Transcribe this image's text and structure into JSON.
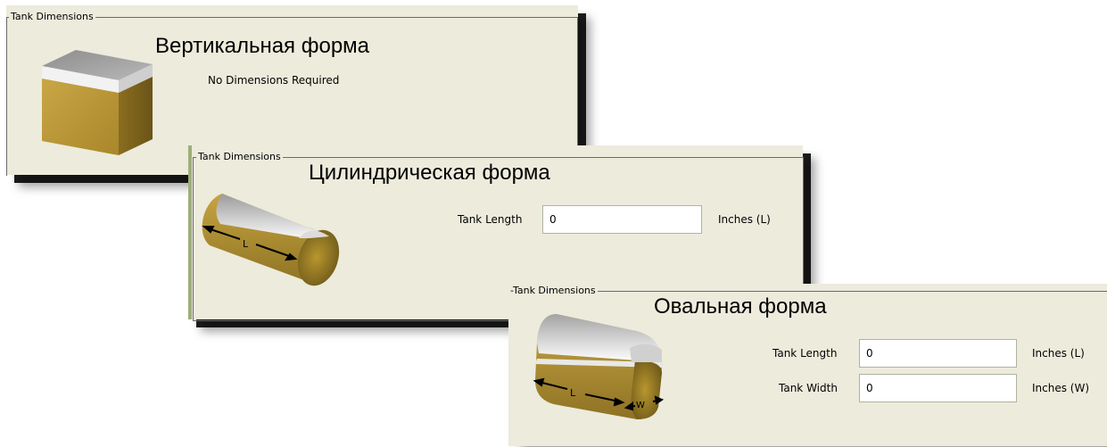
{
  "panels": {
    "vertical": {
      "group_label": "Tank Dimensions",
      "title": "Вертикальная форма",
      "message": "No Dimensions Required"
    },
    "cylindrical": {
      "group_label": "Tank Dimensions",
      "title": "Цилиндрическая форма",
      "length_label": "Tank Length",
      "length_value": "0",
      "length_unit": "Inches (L)",
      "diagram_label_l": "L"
    },
    "oval": {
      "group_label": "-Tank Dimensions",
      "title": "Овальная форма",
      "length_label": "Tank Length",
      "length_value": "0",
      "length_unit": "Inches (L)",
      "width_label": "Tank Width",
      "width_value": "0",
      "width_unit": "Inches (W)",
      "diagram_label_l": "L",
      "diagram_label_w": "W"
    }
  },
  "colors": {
    "panel_bg": "#ecebdc",
    "tank_gold": "#b8962e",
    "tank_silver": "#d9d9d9",
    "field_border": "#aeb59e",
    "accent_left_bar": "#9fae79"
  },
  "icons": [
    "vertical-tank-icon",
    "cylindrical-tank-icon",
    "oval-tank-icon",
    "dimension-arrow-icon"
  ]
}
